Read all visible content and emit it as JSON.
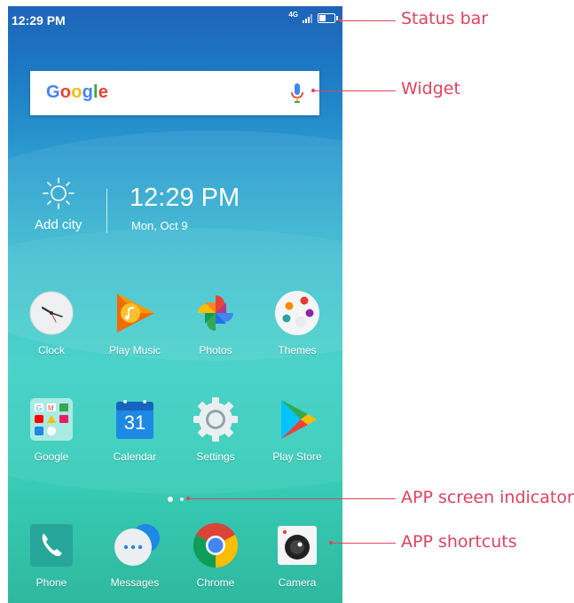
{
  "status_bar": {
    "time": "12:29 PM",
    "network": "4G",
    "battery_level": 0.45
  },
  "widget": {
    "logo": "Google",
    "mic_icon": "mic-icon"
  },
  "weather": {
    "icon": "sun-icon",
    "city": "Add city",
    "time": "12:29 PM",
    "date": "Mon, Oct 9"
  },
  "apps_row1": [
    {
      "label": "Clock",
      "icon": "clock-icon"
    },
    {
      "label": "Play Music",
      "icon": "play-music-icon"
    },
    {
      "label": "Photos",
      "icon": "photos-icon"
    },
    {
      "label": "Themes",
      "icon": "themes-icon"
    }
  ],
  "apps_row2": [
    {
      "label": "Google",
      "icon": "google-folder-icon"
    },
    {
      "label": "Calendar",
      "icon": "calendar-icon",
      "day": "31"
    },
    {
      "label": "Settings",
      "icon": "settings-icon"
    },
    {
      "label": "Play Store",
      "icon": "play-store-icon"
    }
  ],
  "page_indicator": {
    "pages": 2,
    "current": 1
  },
  "dock": [
    {
      "label": "Phone",
      "icon": "phone-icon"
    },
    {
      "label": "Messages",
      "icon": "messages-icon"
    },
    {
      "label": "Chrome",
      "icon": "chrome-icon"
    },
    {
      "label": "Camera",
      "icon": "camera-icon"
    }
  ],
  "annotations": {
    "status_bar": "Status bar",
    "widget": "Widget",
    "screen_indicator": "APP screen indicator",
    "shortcuts": "APP shortcuts"
  },
  "colors": {
    "annotation": "#e0425e",
    "wallpaper_top": "#1e63b8",
    "wallpaper_bottom": "#2fb89e"
  }
}
